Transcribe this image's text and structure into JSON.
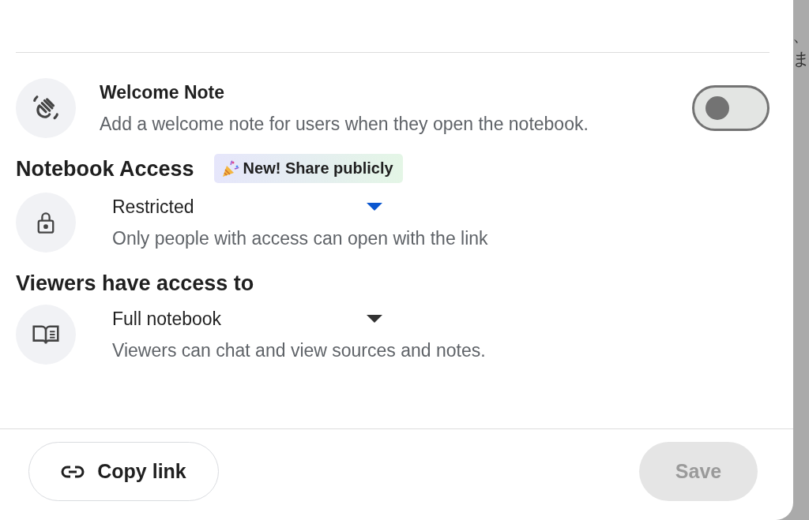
{
  "welcome_note": {
    "title": "Welcome Note",
    "description": "Add a welcome note for users when they open the notebook.",
    "on": false
  },
  "notebook_access": {
    "heading": "Notebook Access",
    "badge": "New! Share publicly",
    "dropdown": {
      "value": "Restricted",
      "focused": true
    },
    "description": "Only people with access can open with the link"
  },
  "viewer_access": {
    "heading": "Viewers have access to",
    "dropdown": {
      "value": "Full notebook",
      "focused": false
    },
    "description": "Viewers can chat and view sources and notes."
  },
  "footer": {
    "copy_link": "Copy link",
    "save": {
      "label": "Save",
      "disabled": true
    }
  },
  "backdrop_text": [
    "、",
    "ま"
  ]
}
